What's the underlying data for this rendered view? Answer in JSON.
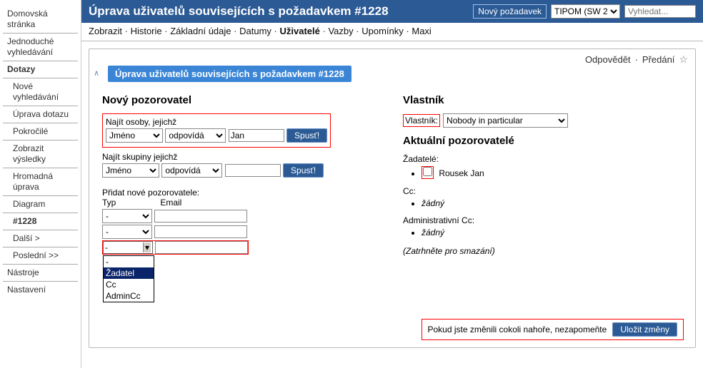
{
  "sidebar": {
    "items": [
      {
        "label": "Domovská stránka",
        "bold": false
      },
      {
        "label": "Jednoduché vyhledávání",
        "bold": false
      },
      {
        "label": "Dotazy",
        "bold": true
      },
      {
        "label": "Nové vyhledávání",
        "indent": true
      },
      {
        "label": "Úprava dotazu",
        "indent": true
      },
      {
        "label": "Pokročilé",
        "indent": true
      },
      {
        "label": "Zobrazit výsledky",
        "indent": true
      },
      {
        "label": "Hromadná úprava",
        "indent": true
      },
      {
        "label": "Diagram",
        "indent": true
      },
      {
        "label": "#1228",
        "indent": true,
        "bold": true
      },
      {
        "label": "Další >",
        "indent": true
      },
      {
        "label": "Poslední >>",
        "indent": true
      },
      {
        "label": "Nástroje"
      },
      {
        "label": "Nastavení",
        "noline": true
      }
    ]
  },
  "header": {
    "title": "Úprava uživatelů souvisejících s požadavkem #1228",
    "new_request": "Nový požadavek",
    "queue_sel": "TIPOM (SW 2",
    "search_placeholder": "Vyhledat..."
  },
  "subnav": {
    "items": [
      "Zobrazit",
      "Historie",
      "Základní údaje",
      "Datumy",
      "Uživatelé",
      "Vazby",
      "Upomínky",
      "Maxi"
    ],
    "active": 4
  },
  "panel": {
    "actions": {
      "reply": "Odpovědět",
      "forward": "Předání"
    },
    "tab": "Úprava uživatelů souvisejících s požadavkem #1228"
  },
  "left": {
    "h_observer": "Nový pozorovatel",
    "find_people": "Najít osoby, jejichž",
    "field_sel": "Jméno",
    "op_sel": "odpovídá",
    "val1": "Jan",
    "run": "Spusť!",
    "find_groups": "Najít skupiny jejichž",
    "val2": "",
    "add_new": "Přidat nové pozorovatele:",
    "col_type": "Typ",
    "col_email": "Email",
    "type_blank": "-",
    "dd_options": [
      "-",
      "Žadatel",
      "Cc",
      "AdminCc"
    ],
    "dd_selected": 1
  },
  "right": {
    "h_owner": "Vlastník",
    "owner_lbl": "Vlastník:",
    "owner_sel": "Nobody in particular",
    "h_watchers": "Aktuální pozorovatelé",
    "req_lbl": "Žadatelé:",
    "req_name": "Rousek Jan",
    "cc_lbl": "Cc:",
    "none": "žádný",
    "admcc_lbl": "Administrativní Cc:",
    "hint": "(Zatrhněte pro smazání)"
  },
  "footer": {
    "msg": "Pokud jste změnili cokoli nahoře, nezapomeňte",
    "save": "Uložit změny"
  }
}
